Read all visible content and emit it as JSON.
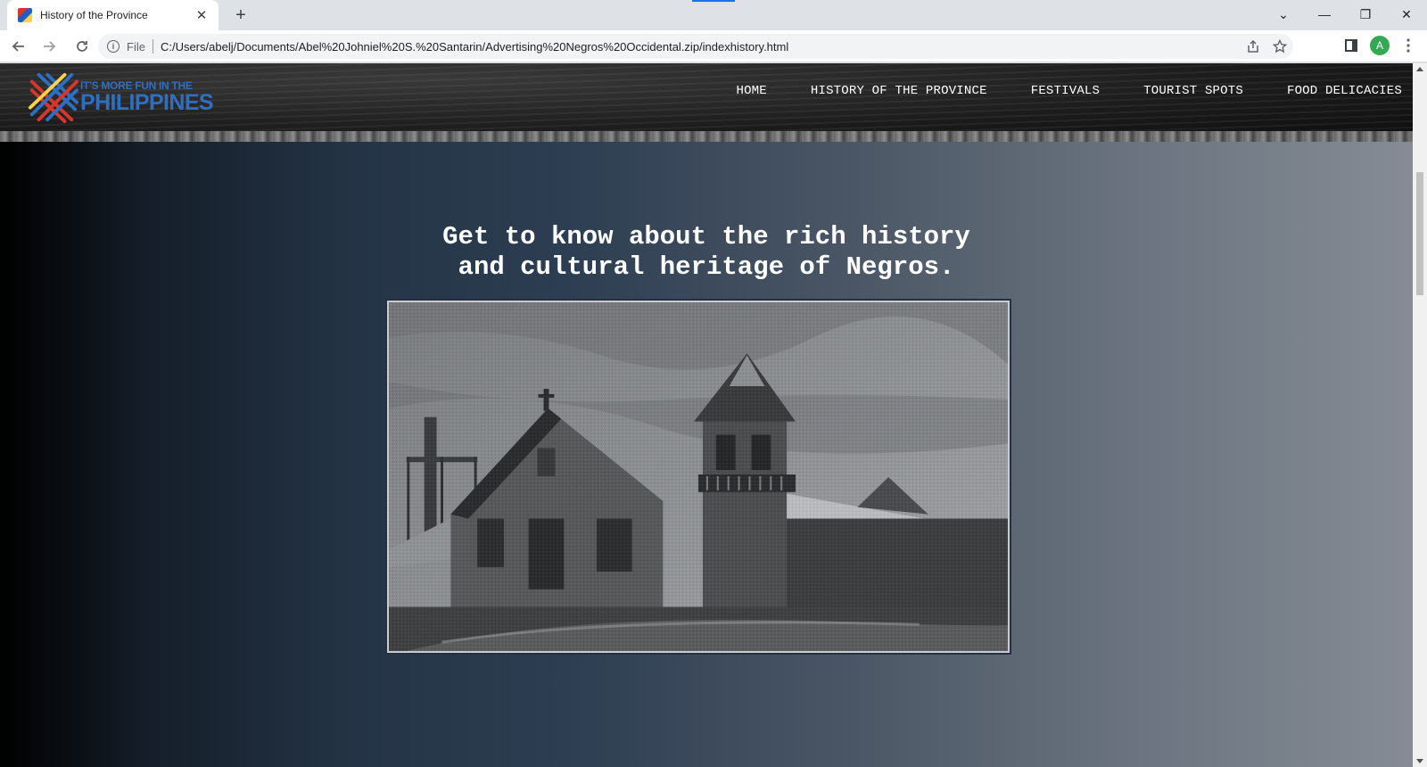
{
  "browser": {
    "tab_title": "History of the Province",
    "new_tab_symbol": "+",
    "close_symbol": "✕",
    "file_label": "File",
    "url": "C:/Users/abelj/Documents/Abel%20Johniel%20S.%20Santarin/Advertising%20Negros%20Occidental.zip/indexhistory.html",
    "profile_initial": "A",
    "window_buttons": [
      "⌄",
      "—",
      "❐",
      "✕"
    ]
  },
  "site": {
    "logo": {
      "line1": "IT'S MORE FUN IN THE",
      "line2": "PHILIPPINES"
    },
    "nav": [
      {
        "label": "HOME"
      },
      {
        "label": "HISTORY OF THE PROVINCE"
      },
      {
        "label": "FESTIVALS"
      },
      {
        "label": "TOURIST SPOTS"
      },
      {
        "label": "FOOD DELICACIES"
      }
    ],
    "headline_line1": "Get to know about the rich history",
    "headline_line2": "and cultural heritage of Negros."
  },
  "colors": {
    "logo_blue": "#2e6fc4",
    "logo_red": "#d8362c",
    "logo_yellow": "#ffd24a",
    "accent": "#1a73e8"
  },
  "icons": [
    "back-arrow-icon",
    "forward-arrow-icon",
    "reload-icon",
    "info-icon",
    "share-icon",
    "star-icon",
    "side-panel-icon",
    "more-vert-icon"
  ]
}
